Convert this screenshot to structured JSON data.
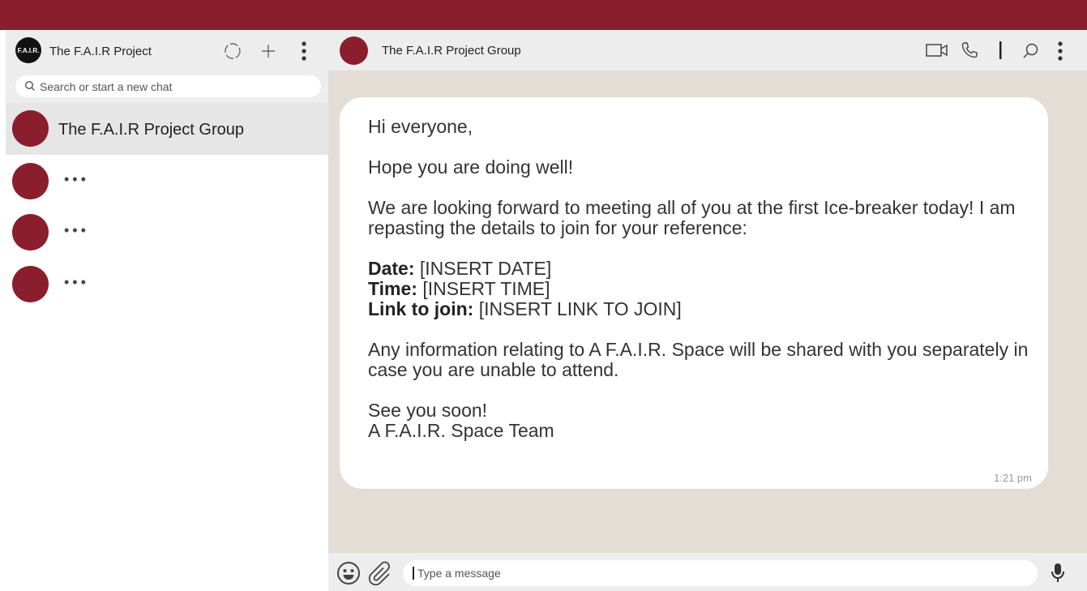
{
  "sidebar": {
    "logo_text": "F.A.I.R.",
    "title": "The F.A.I.R Project",
    "search_placeholder": "Search or start a new chat",
    "chats": [
      {
        "name": "The F.A.I.R Project Group",
        "active": true
      },
      {
        "name": "•••"
      },
      {
        "name": "•••"
      },
      {
        "name": "•••"
      }
    ]
  },
  "header": {
    "title": "The F.A.I.R Project Group"
  },
  "message": {
    "greeting": "Hi everyone,",
    "line1": "Hope you are doing well!",
    "line2": "We are looking forward to meeting all of you at the first Ice-breaker today! I am repasting the details to join for your reference:",
    "date_label": "Date:",
    "date_value": "[INSERT DATE]",
    "time_label": "Time:",
    "time_value": "[INSERT TIME]",
    "link_label": "Link to join:",
    "link_value": "[INSERT LINK TO JOIN]",
    "line3": "Any information relating to A F.A.I.R. Space will be shared with you separately in case you are unable to attend.",
    "signoff1": "See you soon!",
    "signoff2": "A F.A.I.R. Space Team",
    "timestamp": "1:21 pm"
  },
  "composer": {
    "placeholder": "Type a message"
  },
  "colors": {
    "brand": "#8a1e2c",
    "chat_background": "#e4ddd6",
    "header_background": "#ededed"
  },
  "icons": [
    "status-icon",
    "new-chat-icon",
    "menu-icon",
    "video-call-icon",
    "phone-icon",
    "search-icon",
    "emoji-icon",
    "attach-icon",
    "mic-icon"
  ]
}
